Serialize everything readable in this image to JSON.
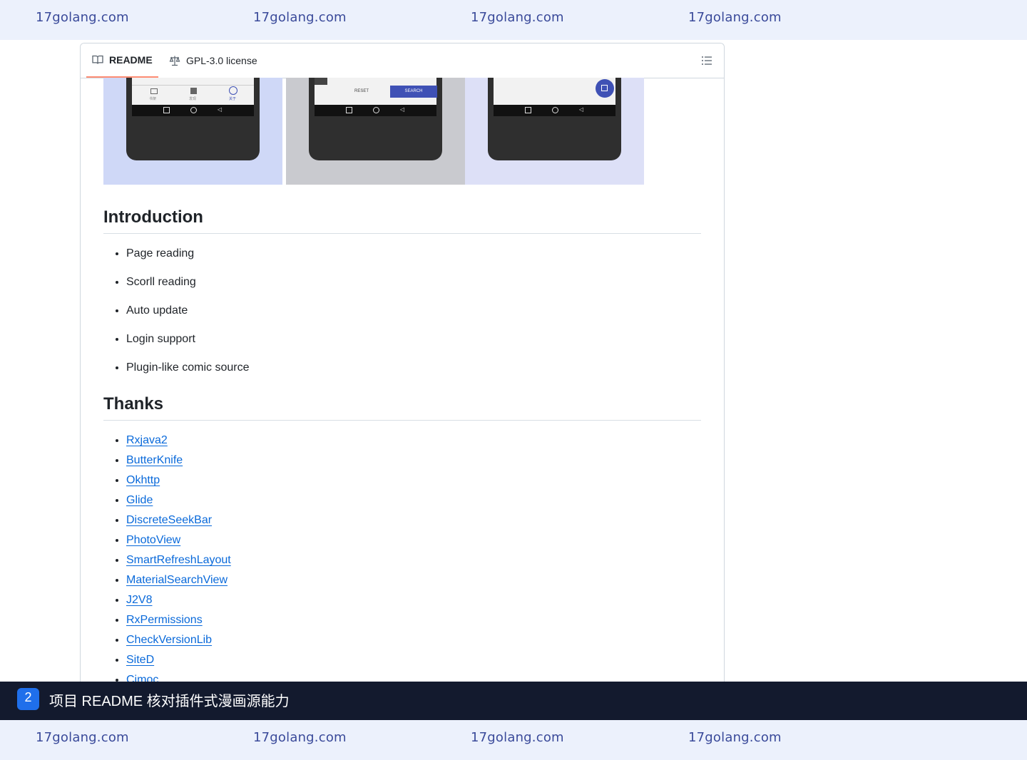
{
  "watermark": {
    "text": "17golang.com"
  },
  "tabs": {
    "readme": "README",
    "license": "GPL-3.0 license"
  },
  "screenshots": {
    "bg_colors": [
      "#cfd8f7",
      "#c9cacf",
      "#dde0f7"
    ],
    "shot1_tabs": [
      "书架",
      "发现",
      "关于"
    ],
    "shot2_buttons": {
      "reset": "RESET",
      "search": "SEARCH"
    }
  },
  "introduction": {
    "heading": "Introduction",
    "items": [
      "Page reading",
      "Scorll reading",
      "Auto update",
      "Login support",
      "Plugin-like comic source"
    ]
  },
  "thanks": {
    "heading": "Thanks",
    "items": [
      "Rxjava2",
      "ButterKnife",
      "Okhttp",
      "Glide",
      "DiscreteSeekBar",
      "PhotoView",
      "SmartRefreshLayout",
      "MaterialSearchView",
      "J2V8",
      "RxPermissions",
      "CheckVersionLib",
      "SiteD",
      "Cimoc"
    ]
  },
  "footer": {
    "step": "2",
    "caption": "项目 README 核对插件式漫画源能力"
  },
  "colors": {
    "accent": "#0969da",
    "tab_underline": "#fd8c73",
    "strip_bg": "#131a2e",
    "badge": "#1f6feb"
  }
}
